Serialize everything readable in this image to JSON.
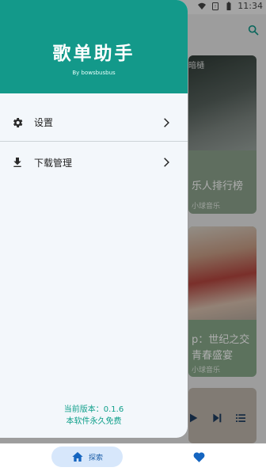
{
  "status_bar": {
    "time": "11:34"
  },
  "background": {
    "cards": [
      {
        "overlay_text": "暗樋",
        "title": "乐人排行榜",
        "subtitle": "小球音乐"
      },
      {
        "title": "p：世纪之交",
        "title2": "青春盛宴",
        "subtitle": "小球音乐"
      }
    ]
  },
  "drawer": {
    "title": "歌单助手",
    "byline": "By bowsbusbus",
    "menu": [
      {
        "label": "设置",
        "icon": "gear-icon"
      },
      {
        "label": "下载管理",
        "icon": "download-icon"
      }
    ],
    "version": "当前版本：0.1.6",
    "free_note": "本软件永久免费"
  },
  "bottom_nav": {
    "explore_label": "探索",
    "explore_icon": "home-icon",
    "favorites_icon": "heart-icon"
  },
  "colors": {
    "header": "#13998a",
    "accent_text": "#0e9f8a",
    "nav_active_bg": "#d7e7fb",
    "nav_icon": "#1565c0"
  }
}
